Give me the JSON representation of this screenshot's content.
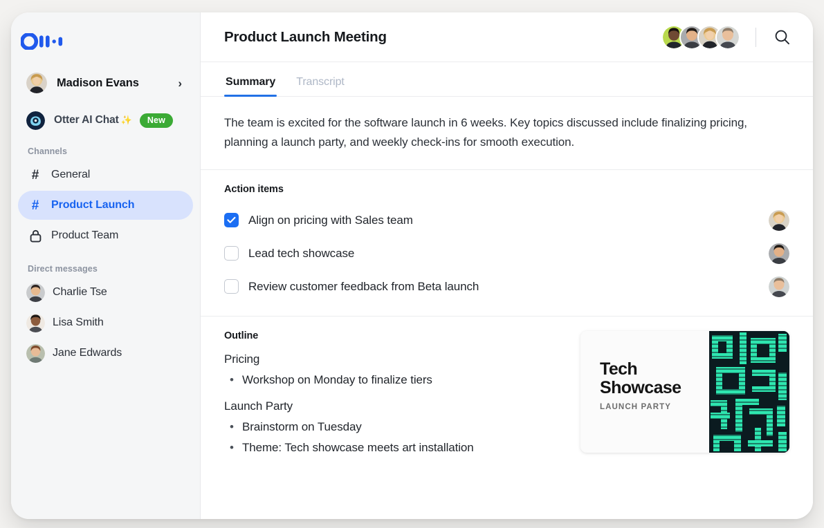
{
  "sidebar": {
    "logo_name": "otter-logo",
    "user": {
      "name": "Madison Evans",
      "chevron": "›"
    },
    "otter_chat": {
      "label": "Otter AI Chat",
      "sparkle": "✨",
      "badge": "New"
    },
    "channels_label": "Channels",
    "channels": [
      {
        "glyph": "#",
        "label": "General",
        "active": false,
        "icon": "hash-icon"
      },
      {
        "glyph": "#",
        "label": "Product Launch",
        "active": true,
        "icon": "hash-icon"
      },
      {
        "glyph": "lock",
        "label": "Product Team",
        "active": false,
        "icon": "lock-icon"
      }
    ],
    "dm_label": "Direct messages",
    "direct_messages": [
      {
        "name": "Charlie Tse"
      },
      {
        "name": "Lisa Smith"
      },
      {
        "name": "Jane Edwards"
      }
    ]
  },
  "header": {
    "title": "Product Launch Meeting",
    "search_icon": "search-icon",
    "participant_count": 4
  },
  "tabs": [
    {
      "label": "Summary",
      "active": true
    },
    {
      "label": "Transcript",
      "active": false
    }
  ],
  "summary": {
    "text": "The team is excited for the software launch in 6 weeks. Key topics discussed include finalizing pricing, planning a launch party, and weekly check-ins for smooth execution."
  },
  "action_items": {
    "heading": "Action items",
    "items": [
      {
        "label": "Align on pricing with Sales team",
        "checked": true
      },
      {
        "label": "Lead tech showcase",
        "checked": false
      },
      {
        "label": "Review customer feedback from Beta launch",
        "checked": false
      }
    ]
  },
  "outline": {
    "heading": "Outline",
    "groups": [
      {
        "topic": "Pricing",
        "bullets": [
          "Workshop on Monday to finalize tiers"
        ]
      },
      {
        "topic": "Launch Party",
        "bullets": [
          "Brainstorm on Tuesday",
          "Theme: Tech showcase meets art installation"
        ]
      }
    ]
  },
  "tech_card": {
    "title_line1": "Tech",
    "title_line2": "Showcase",
    "subtitle": "LAUNCH PARTY"
  },
  "colors": {
    "brand_blue": "#1B6EF3",
    "active_nav_bg": "#d8e2fd",
    "active_nav_text": "#1863f0",
    "badge_green": "#3BAA35",
    "tab_underline": "#2271e6",
    "tech_art_teal": "#2ee6b0",
    "tech_art_bg": "#0c1c20"
  }
}
